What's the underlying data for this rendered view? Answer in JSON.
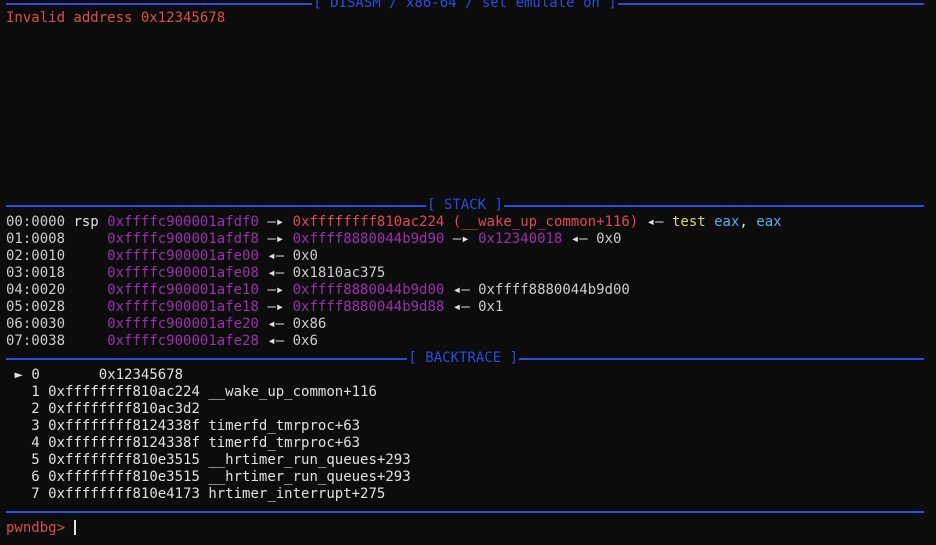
{
  "disasm": {
    "header": "[ DISASM / x86-64 / set emulate on ]",
    "message": "Invalid address 0x12345678"
  },
  "stack": {
    "header": "[ STACK ]",
    "rows": [
      {
        "index": "00:0000",
        "reg": "rsp",
        "addr": "0xffffc900001afdf0",
        "arrow1": "—▸",
        "val1": "0xffffffff810ac224",
        "sym": "(__wake_up_common+116)",
        "arrow2": "◂—",
        "instr_op": "test",
        "instr_a": "eax",
        "instr_sep": ",",
        "instr_b": "eax"
      },
      {
        "index": "01:0008",
        "reg": "",
        "addr": "0xffffc900001afdf8",
        "arrow1": "—▸",
        "val1": "0xffff8880044b9d90",
        "arrow2": "—▸",
        "val2": "0x12340018",
        "arrow3": "◂—",
        "val3": "0x0"
      },
      {
        "index": "02:0010",
        "reg": "",
        "addr": "0xffffc900001afe00",
        "arrow1": "◂—",
        "val1": "0x0"
      },
      {
        "index": "03:0018",
        "reg": "",
        "addr": "0xffffc900001afe08",
        "arrow1": "◂—",
        "val1": "0x1810ac375"
      },
      {
        "index": "04:0020",
        "reg": "",
        "addr": "0xffffc900001afe10",
        "arrow1": "—▸",
        "val1": "0xffff8880044b9d00",
        "arrow2": "◂—",
        "val2": "0xffff8880044b9d00"
      },
      {
        "index": "05:0028",
        "reg": "",
        "addr": "0xffffc900001afe18",
        "arrow1": "—▸",
        "val1": "0xffff8880044b9d88",
        "arrow2": "◂—",
        "val2": "0x1"
      },
      {
        "index": "06:0030",
        "reg": "",
        "addr": "0xffffc900001afe20",
        "arrow1": "◂—",
        "val1": "0x86"
      },
      {
        "index": "07:0038",
        "reg": "",
        "addr": "0xffffc900001afe28",
        "arrow1": "◂—",
        "val1": "0x6"
      }
    ]
  },
  "backtrace": {
    "header": "[ BACKTRACE ]",
    "marker": "►",
    "frames": [
      {
        "num": "0",
        "addr": "0x12345678",
        "sym": ""
      },
      {
        "num": "1",
        "addr": "0xffffffff810ac224",
        "sym": "__wake_up_common+116"
      },
      {
        "num": "2",
        "addr": "0xffffffff810ac3d2",
        "sym": ""
      },
      {
        "num": "3",
        "addr": "0xffffffff8124338f",
        "sym": "timerfd_tmrproc+63"
      },
      {
        "num": "4",
        "addr": "0xffffffff8124338f",
        "sym": "timerfd_tmrproc+63"
      },
      {
        "num": "5",
        "addr": "0xffffffff810e3515",
        "sym": "__hrtimer_run_queues+293"
      },
      {
        "num": "6",
        "addr": "0xffffffff810e3515",
        "sym": "__hrtimer_run_queues+293"
      },
      {
        "num": "7",
        "addr": "0xffffffff810e4173",
        "sym": "hrtimer_interrupt+275"
      }
    ]
  },
  "prompt": {
    "text": "pwndbg>",
    "input": ""
  },
  "colors": {
    "background": "#0c0c0c",
    "section_blue": "#2a4de0",
    "error_red": "#e04858",
    "stack_purple": "#9b2fae",
    "instr_yellow": "#d8d85a",
    "reg_cyan": "#4fb0e8"
  }
}
